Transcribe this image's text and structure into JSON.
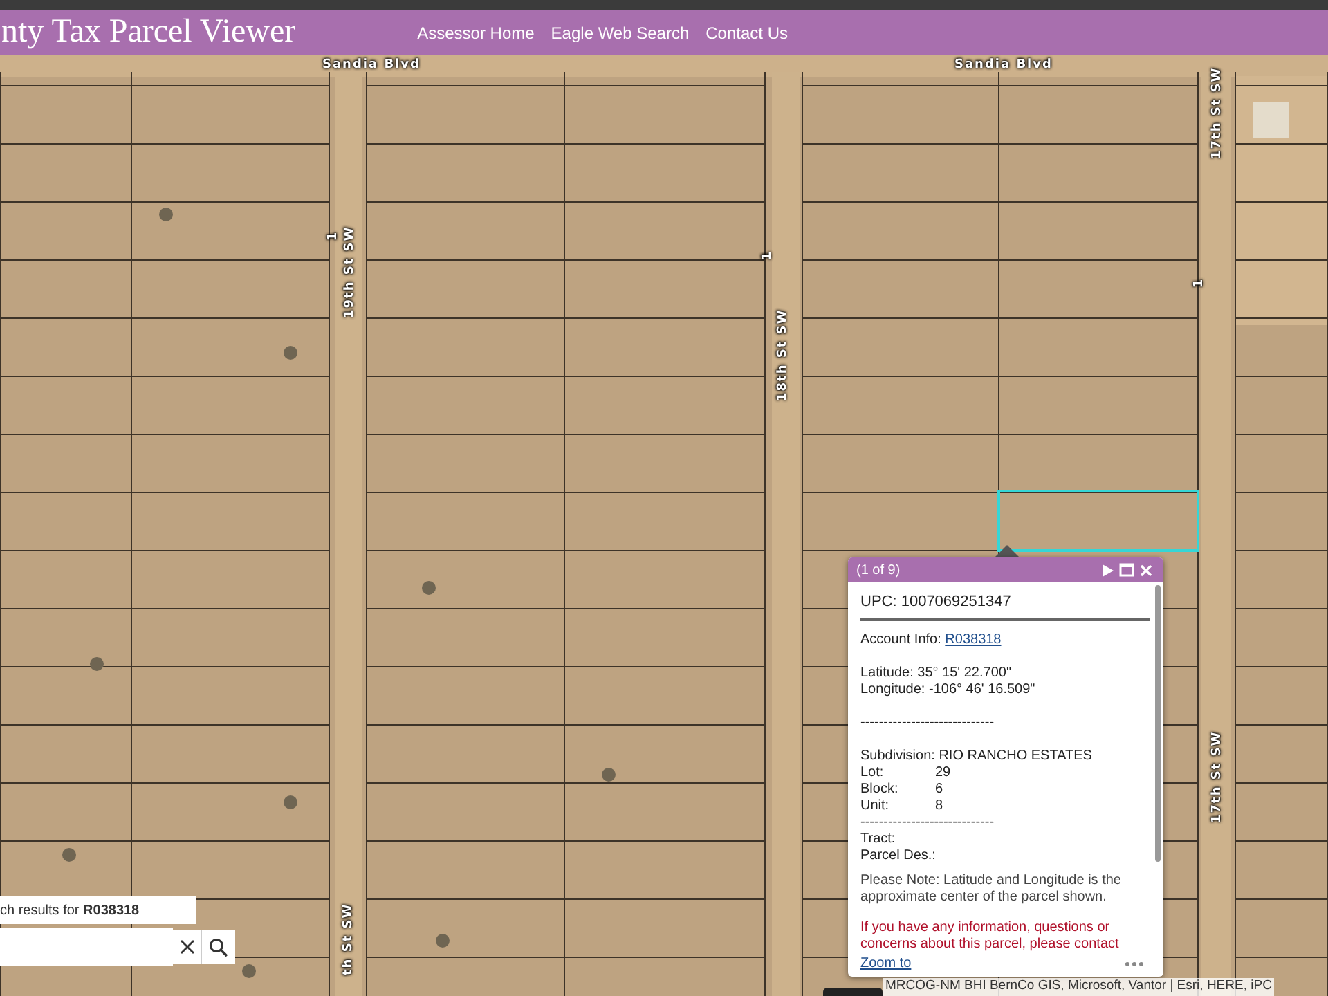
{
  "header": {
    "title": "nty Tax Parcel Viewer",
    "nav": [
      {
        "label": "Assessor Home"
      },
      {
        "label": "Eagle Web Search"
      },
      {
        "label": "Contact Us"
      }
    ]
  },
  "map_labels": [
    {
      "kind": "street",
      "text": "Sandia Blvd"
    },
    {
      "kind": "street",
      "text": "Sandia Blvd"
    },
    {
      "kind": "vstreet",
      "text": "19th St SW"
    },
    {
      "kind": "vstreet",
      "text": "18th St SW"
    },
    {
      "kind": "vstreet",
      "text": "17th St SW"
    },
    {
      "kind": "vstreet",
      "text": "17th St SW"
    },
    {
      "kind": "vstreet",
      "text": "th St SW"
    },
    {
      "kind": "number",
      "text": "1"
    },
    {
      "kind": "number",
      "text": "1"
    },
    {
      "kind": "number",
      "text": "1"
    }
  ],
  "popup": {
    "title": "(1 of 9)",
    "upc": "UPC: 1007069251347",
    "account_label": "Account Info:",
    "account_link": "R038318",
    "latitude": "Latitude: 35° 15' 22.700\"",
    "longitude": "Longitude: -106° 46' 16.509\"",
    "separator_1": "-----------------------------",
    "subdivision": "Subdivision: RIO RANCHO ESTATES",
    "fields": [
      {
        "label": "Lot:",
        "value": "29"
      },
      {
        "label": "Block:",
        "value": "6"
      },
      {
        "label": "Unit:",
        "value": "8"
      }
    ],
    "separator_2": "-----------------------------",
    "tract": "Tract:",
    "parcel_des": "Parcel Des.:",
    "note": "Please Note: Latitude and Longitude is the approximate center of the parcel shown.",
    "warning": "If you have any information, questions or concerns about this parcel, please contact",
    "zoom_link": "Zoom to"
  },
  "search": {
    "results": "ch results for **R038318**"
  },
  "attribution": "MRCOG-NM BHI BernCo GIS, Microsoft, Vantor | Esri, HERE, iPC"
}
